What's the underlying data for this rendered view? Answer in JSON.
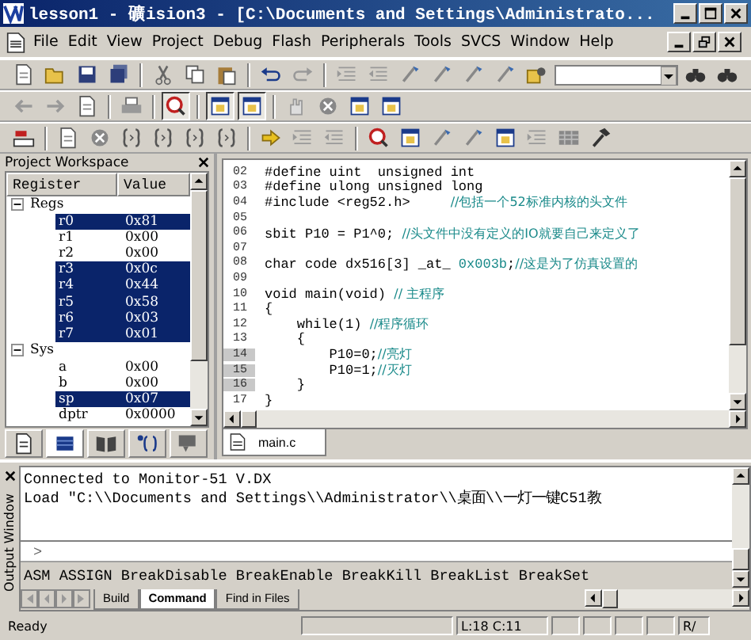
{
  "window": {
    "title": "lesson1  - 礦ision3 - [C:\\Documents and Settings\\Administrato..."
  },
  "menu": [
    "File",
    "Edit",
    "View",
    "Project",
    "Debug",
    "Flash",
    "Peripherals",
    "Tools",
    "SVCS",
    "Window",
    "Help"
  ],
  "toolbars": [
    {
      "buttons": [
        {
          "kind": "new-file",
          "pressed": false
        },
        {
          "kind": "open",
          "pressed": false
        },
        {
          "kind": "save",
          "pressed": false
        },
        {
          "kind": "save-all",
          "pressed": false
        },
        {
          "kind": "sep"
        },
        {
          "kind": "cut",
          "pressed": false
        },
        {
          "kind": "copy",
          "pressed": false
        },
        {
          "kind": "paste",
          "pressed": false
        },
        {
          "kind": "sep"
        },
        {
          "kind": "undo",
          "pressed": false
        },
        {
          "kind": "redo",
          "pressed": false
        },
        {
          "kind": "sep"
        },
        {
          "kind": "indent",
          "pressed": false
        },
        {
          "kind": "outdent",
          "pressed": false
        },
        {
          "kind": "bookmark",
          "pressed": false
        },
        {
          "kind": "bookmark",
          "pressed": false
        },
        {
          "kind": "bookmark",
          "pressed": false
        },
        {
          "kind": "bookmark",
          "pressed": false
        },
        {
          "kind": "find-files",
          "pressed": false
        },
        {
          "kind": "combo"
        },
        {
          "kind": "find",
          "pressed": false
        },
        {
          "kind": "find",
          "pressed": false
        }
      ]
    },
    {
      "buttons": [
        {
          "kind": "back",
          "pressed": false
        },
        {
          "kind": "forward",
          "pressed": false
        },
        {
          "kind": "page",
          "pressed": false
        },
        {
          "kind": "sep"
        },
        {
          "kind": "print",
          "pressed": false
        },
        {
          "kind": "sep"
        },
        {
          "kind": "debug",
          "pressed": true
        },
        {
          "kind": "sep"
        },
        {
          "kind": "window",
          "pressed": true
        },
        {
          "kind": "window",
          "pressed": true
        },
        {
          "kind": "sep"
        },
        {
          "kind": "hand",
          "pressed": false
        },
        {
          "kind": "stop",
          "pressed": false
        },
        {
          "kind": "window",
          "pressed": false
        },
        {
          "kind": "window",
          "pressed": false
        }
      ]
    },
    {
      "buttons": [
        {
          "kind": "reset",
          "pressed": false
        },
        {
          "kind": "sep"
        },
        {
          "kind": "page",
          "pressed": false
        },
        {
          "kind": "stop",
          "pressed": false
        },
        {
          "kind": "step",
          "pressed": false
        },
        {
          "kind": "step",
          "pressed": false
        },
        {
          "kind": "step",
          "pressed": false
        },
        {
          "kind": "step",
          "pressed": false
        },
        {
          "kind": "sep"
        },
        {
          "kind": "run",
          "pressed": false
        },
        {
          "kind": "indent",
          "pressed": false
        },
        {
          "kind": "outdent",
          "pressed": false
        },
        {
          "kind": "sep"
        },
        {
          "kind": "debug",
          "pressed": false
        },
        {
          "kind": "window",
          "pressed": false
        },
        {
          "kind": "bookmark",
          "pressed": false
        },
        {
          "kind": "bookmark",
          "pressed": false
        },
        {
          "kind": "window",
          "pressed": false
        },
        {
          "kind": "indent",
          "pressed": false
        },
        {
          "kind": "memory",
          "pressed": false
        },
        {
          "kind": "hammer",
          "pressed": false
        }
      ]
    }
  ],
  "workspace": {
    "title": "Project Workspace",
    "columns": [
      "Register",
      "Value"
    ],
    "groups": [
      {
        "label": "Regs",
        "expanded": true,
        "children": [
          {
            "name": "r0",
            "value": "0x81",
            "selected": true
          },
          {
            "name": "r1",
            "value": "0x00",
            "selected": false
          },
          {
            "name": "r2",
            "value": "0x00",
            "selected": false
          },
          {
            "name": "r3",
            "value": "0x0c",
            "selected": true
          },
          {
            "name": "r4",
            "value": "0x44",
            "selected": true
          },
          {
            "name": "r5",
            "value": "0x58",
            "selected": true
          },
          {
            "name": "r6",
            "value": "0x03",
            "selected": true
          },
          {
            "name": "r7",
            "value": "0x01",
            "selected": true
          }
        ]
      },
      {
        "label": "Sys",
        "expanded": true,
        "children": [
          {
            "name": "a",
            "value": "0x00",
            "selected": false
          },
          {
            "name": "b",
            "value": "0x00",
            "selected": false
          },
          {
            "name": "sp",
            "value": "0x07",
            "selected": true
          },
          {
            "name": "dptr",
            "value": "0x0000",
            "selected": false
          }
        ]
      }
    ],
    "tabs": [
      {
        "kind": "files",
        "selected": false
      },
      {
        "kind": "regs",
        "selected": true
      },
      {
        "kind": "books",
        "selected": false
      },
      {
        "kind": "functions",
        "selected": false
      },
      {
        "kind": "templates",
        "selected": false
      }
    ]
  },
  "editor": {
    "lines": [
      {
        "num": "02",
        "segments": [
          {
            "kind": "code",
            "text": "#define uint  unsigned int"
          }
        ]
      },
      {
        "num": "03",
        "segments": [
          {
            "kind": "code",
            "text": "#define ulong unsigned long"
          }
        ]
      },
      {
        "num": "04",
        "segments": [
          {
            "kind": "code",
            "text": "#include <reg52.h>     "
          },
          {
            "kind": "comment",
            "text": "//包括一个52标准内核的头文件"
          }
        ]
      },
      {
        "num": "05"
      },
      {
        "num": "06",
        "segments": [
          {
            "kind": "code",
            "text": "sbit P10 = P1^0; "
          },
          {
            "kind": "comment",
            "text": "//头文件中没有定义的IO就要自己来定义了"
          }
        ]
      },
      {
        "num": "07"
      },
      {
        "num": "08",
        "segments": [
          {
            "kind": "code",
            "text": "char code dx516[3] _at_ "
          },
          {
            "kind": "number",
            "text": "0x003b"
          },
          {
            "kind": "code",
            "text": ";"
          },
          {
            "kind": "comment",
            "text": "//这是为了仿真设置的"
          }
        ]
      },
      {
        "num": "09"
      },
      {
        "num": "10",
        "segments": [
          {
            "kind": "code",
            "text": "void main(void) "
          },
          {
            "kind": "comment",
            "text": "// 主程序"
          }
        ]
      },
      {
        "num": "11",
        "segments": [
          {
            "kind": "code",
            "text": "{"
          }
        ]
      },
      {
        "num": "12",
        "segments": [
          {
            "kind": "code",
            "text": "    while(1) "
          },
          {
            "kind": "comment",
            "text": "//程序循环"
          }
        ]
      },
      {
        "num": "13",
        "segments": [
          {
            "kind": "code",
            "text": "    {"
          }
        ]
      },
      {
        "num": "14",
        "segments": [
          {
            "kind": "code",
            "text": "        P10=0;"
          },
          {
            "kind": "comment",
            "text": "//亮灯"
          }
        ]
      },
      {
        "num": "15",
        "segments": [
          {
            "kind": "code",
            "text": "        P10=1;"
          },
          {
            "kind": "comment",
            "text": "//灭灯"
          }
        ]
      },
      {
        "num": "16",
        "segments": [
          {
            "kind": "code",
            "text": "    }"
          }
        ]
      },
      {
        "num": "17",
        "segments": [
          {
            "kind": "code",
            "text": "}"
          }
        ]
      }
    ],
    "tabs": [
      {
        "label": "main.c",
        "selected": true
      }
    ]
  },
  "output": {
    "title": "Output Window",
    "lines": [
      "Connected to Monitor-51 V.DX",
      "Load \"C:\\\\Documents and Settings\\\\Administrator\\\\桌面\\\\一灯一键C51教"
    ],
    "prompt": ">",
    "hint": "ASM ASSIGN BreakDisable BreakEnable BreakKill BreakList BreakSet",
    "tabs": [
      {
        "label": "Build",
        "selected": false
      },
      {
        "label": "Command",
        "selected": true
      },
      {
        "label": "Find in Files",
        "selected": false
      }
    ]
  },
  "status_bar": {
    "message": "Ready",
    "position": "L:18 C:11",
    "mode": "R/"
  }
}
